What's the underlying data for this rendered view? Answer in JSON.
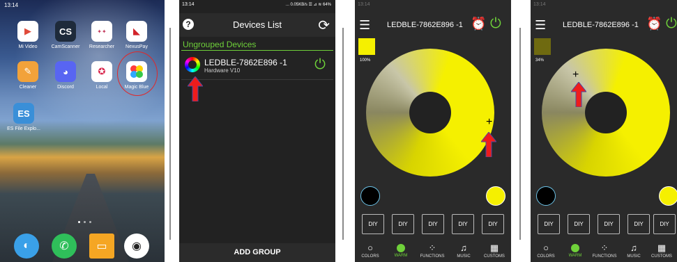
{
  "screen1": {
    "status_time": "13:14",
    "apps": [
      {
        "label": "Mi Video",
        "icon": "play-icon",
        "color": "#ffffff"
      },
      {
        "label": "CamScanner",
        "icon": "CS",
        "color": "#1e2a3a"
      },
      {
        "label": "Researcher",
        "icon": "researcher-icon",
        "color": "#ffffff"
      },
      {
        "label": "NexusPay",
        "icon": "nexuspay-icon",
        "color": "#ffffff"
      },
      {
        "label": "Cleaner",
        "icon": "broom-icon",
        "color": "#f2a23a"
      },
      {
        "label": "Discord",
        "icon": "discord-icon",
        "color": "#5865f2"
      },
      {
        "label": "Local",
        "icon": "local-icon",
        "color": "#ffffff"
      },
      {
        "label": "Magic Blue",
        "icon": "magic-blue-icon",
        "color": "#ffffff"
      },
      {
        "label": "ES File Explo...",
        "icon": "es-file-icon",
        "color": "#3a8fd8"
      }
    ],
    "dock": [
      {
        "icon": "browser-icon",
        "color": "#3aa0e8"
      },
      {
        "icon": "phone-icon",
        "color": "#2fbf5a"
      },
      {
        "icon": "messages-icon",
        "color": "#f5a623"
      },
      {
        "icon": "camera-icon",
        "color": "#ffffff"
      }
    ]
  },
  "screen2": {
    "status_time": "13:14",
    "status_right": "... 0.05KB/s ☰ ⊿ ≋ 64%",
    "title": "Devices List",
    "group_label": "Ungrouped Devices",
    "device_name": "LEDBLE-7862E896 -1",
    "device_sub": "Hardware V10",
    "add_group": "ADD GROUP",
    "accent": "#6fd13a"
  },
  "screen3": {
    "device_name": "LEDBLE-7862E896 -1",
    "brightness_pct": "100%",
    "swatch_color": "#f5f000",
    "diy_buttons": [
      "DIY",
      "DIY",
      "DIY",
      "DIY",
      "DIY"
    ],
    "nav": [
      "COLORS",
      "WARM",
      "FUNCTIONS",
      "MUSIC",
      "CUSTOMS"
    ]
  },
  "screen4": {
    "device_name": "LEDBLE-7862E896 -1",
    "brightness_pct": "34%",
    "swatch_color": "#6f6a10",
    "diy_buttons": [
      "DIY",
      "DIY",
      "DIY",
      "DIY",
      "DIY"
    ],
    "nav": [
      "COLORS",
      "WARM",
      "FUNCTIONS",
      "MUSIC",
      "CUSTOMS"
    ]
  }
}
